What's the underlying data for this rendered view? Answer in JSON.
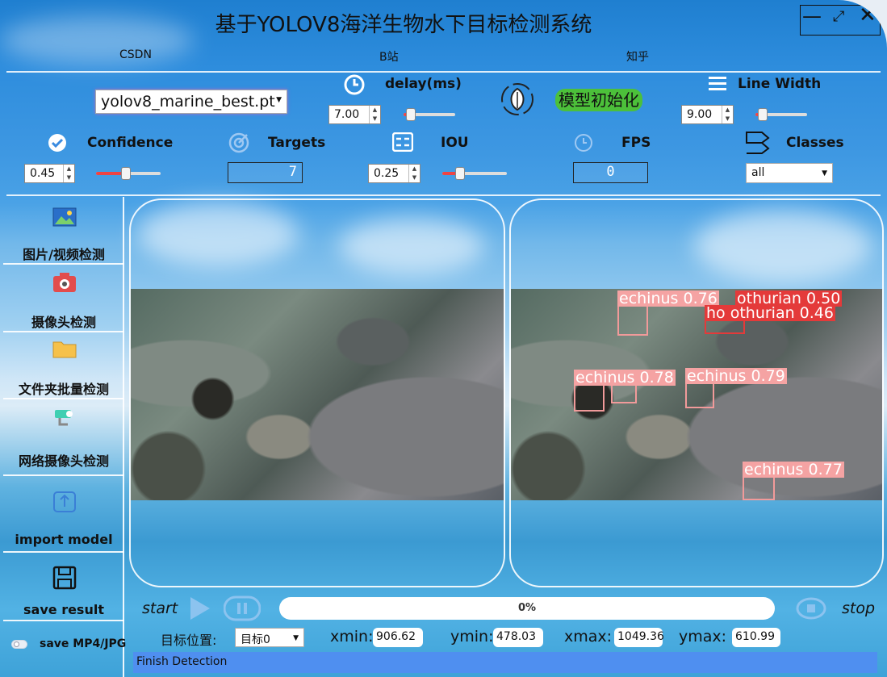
{
  "window": {
    "title": "基于YOLOV8海洋生物水下目标检测系统",
    "links": [
      "CSDN",
      "B站",
      "知乎"
    ]
  },
  "controls": {
    "model_select": "yolov8_marine_best.pt",
    "delay_label": "delay(ms)",
    "delay_value": "7.00",
    "init_button": "模型初始化",
    "line_width_label": "Line Width",
    "line_width_value": "9.00",
    "confidence_label": "Confidence",
    "confidence_value": "0.45",
    "targets_label": "Targets",
    "targets_value": "7",
    "iou_label": "IOU",
    "iou_value": "0.25",
    "fps_label": "FPS",
    "fps_value": "0",
    "classes_label": "Classes",
    "classes_value": "all"
  },
  "sidebar": {
    "items": [
      {
        "label": "图片/视频检测",
        "icon": "image-icon"
      },
      {
        "label": "摄像头检测",
        "icon": "camera-icon"
      },
      {
        "label": "文件夹批量检测",
        "icon": "folder-icon"
      },
      {
        "label": "网络摄像头检测",
        "icon": "network-camera-icon"
      },
      {
        "label": "import model",
        "icon": "import-icon"
      },
      {
        "label": "save result",
        "icon": "save-icon"
      },
      {
        "label": "save MP4/JPG",
        "icon": "toggle-icon"
      }
    ]
  },
  "detections": [
    {
      "label": "echinus  0.76"
    },
    {
      "label": "othurian  0.50"
    },
    {
      "label": "ho othurian  0.46"
    },
    {
      "label": "echinus  0.78"
    },
    {
      "label": "echinus  0.79"
    },
    {
      "label": "echinus  0.77"
    }
  ],
  "playback": {
    "start_label": "start",
    "stop_label": "stop",
    "progress_text": "0%",
    "progress": 0
  },
  "position": {
    "label": "目标位置:",
    "target_select": "目标0",
    "xmin_label": "xmin:",
    "xmin": "906.62",
    "ymin_label": "ymin:",
    "ymin": "478.03",
    "xmax_label": "xmax:",
    "xmax": "1049.36",
    "ymax_label": "ymax:",
    "ymax": "610.99"
  },
  "status": "Finish Detection",
  "colors": {
    "accent_green": "#4cc03a",
    "box_pink": "#f5a3a3",
    "box_red": "#e43a3a",
    "status_bar": "#4f8ff0"
  }
}
